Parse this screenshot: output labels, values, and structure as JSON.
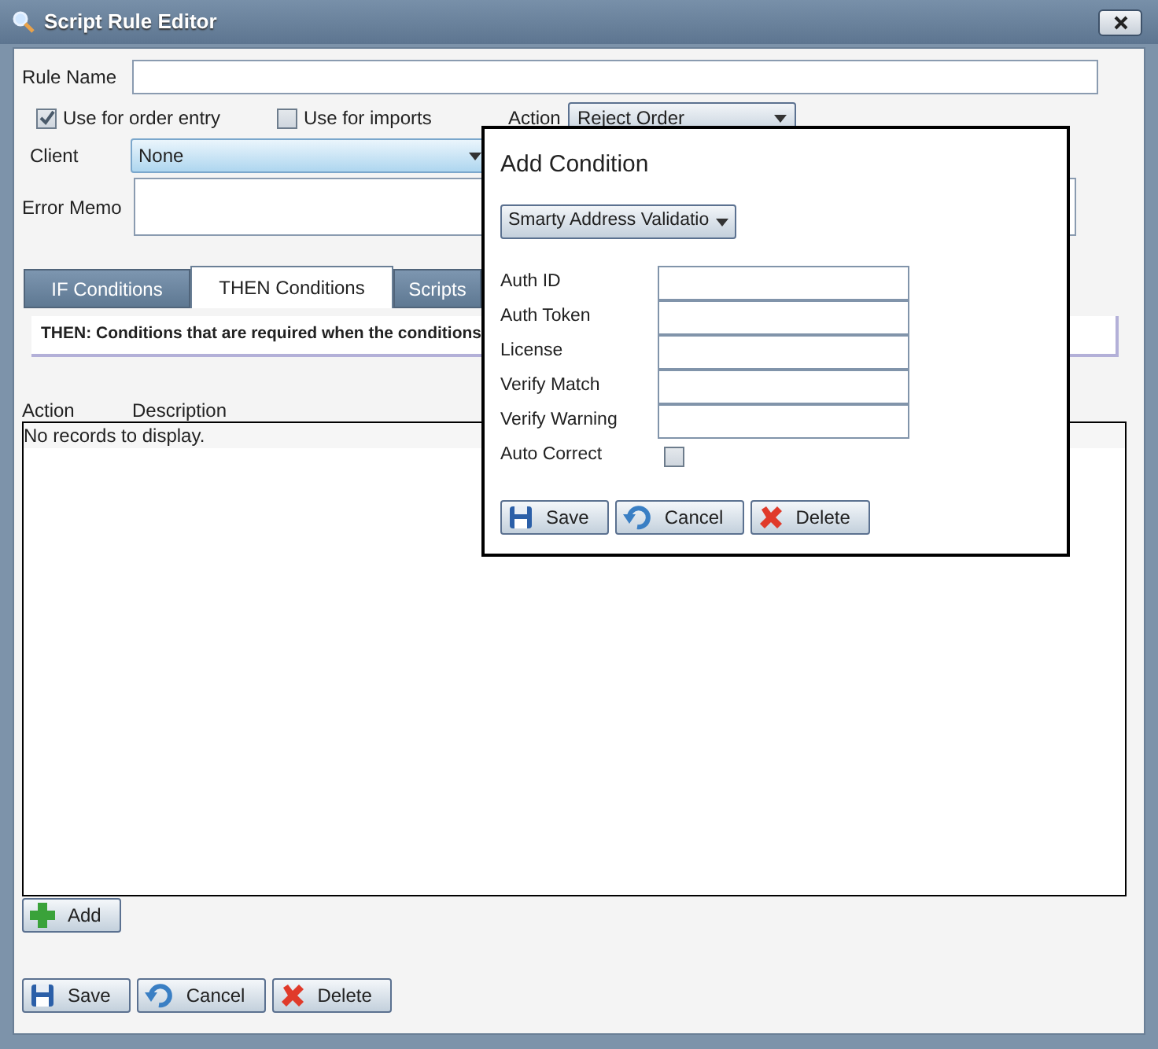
{
  "window": {
    "title": "Script Rule Editor"
  },
  "form": {
    "rule_name": {
      "label": "Rule Name"
    },
    "checkboxes": [
      {
        "label": "Use for order entry",
        "checked": true
      },
      {
        "label": "Use for imports",
        "checked": false
      }
    ],
    "action": {
      "label": "Action",
      "value": "Reject Order"
    },
    "client": {
      "label": "Client",
      "value": "None"
    },
    "error_memo": {
      "label": "Error Memo"
    }
  },
  "tabs": [
    {
      "label": "IF Conditions",
      "selected": false
    },
    {
      "label": "THEN Conditions",
      "selected": true
    },
    {
      "label": "Scripts",
      "selected": false
    }
  ],
  "instruction": "THEN: Conditions that are required when the conditions",
  "grid": {
    "columns": [
      "Action",
      "Description"
    ],
    "empty_text": "No records to display."
  },
  "add_button": {
    "kind": "add",
    "label": "Add"
  },
  "buttons": [
    {
      "kind": "save",
      "label": "Save"
    },
    {
      "kind": "cancel",
      "label": "Cancel"
    },
    {
      "kind": "delete",
      "label": "Delete"
    }
  ],
  "dialog": {
    "title": "Add Condition",
    "condition_type": "Smarty Address Validatio",
    "fields": [
      {
        "kind": "text",
        "label": "Auth ID"
      },
      {
        "kind": "text",
        "label": "Auth Token"
      },
      {
        "kind": "text",
        "label": "License"
      },
      {
        "kind": "text",
        "label": "Verify Match"
      },
      {
        "kind": "text",
        "label": "Verify Warning"
      },
      {
        "kind": "checkbox",
        "label": "Auto Correct",
        "checked": false
      }
    ],
    "buttons": [
      {
        "kind": "save",
        "label": "Save"
      },
      {
        "kind": "cancel",
        "label": "Cancel"
      },
      {
        "kind": "delete",
        "label": "Delete"
      }
    ]
  }
}
